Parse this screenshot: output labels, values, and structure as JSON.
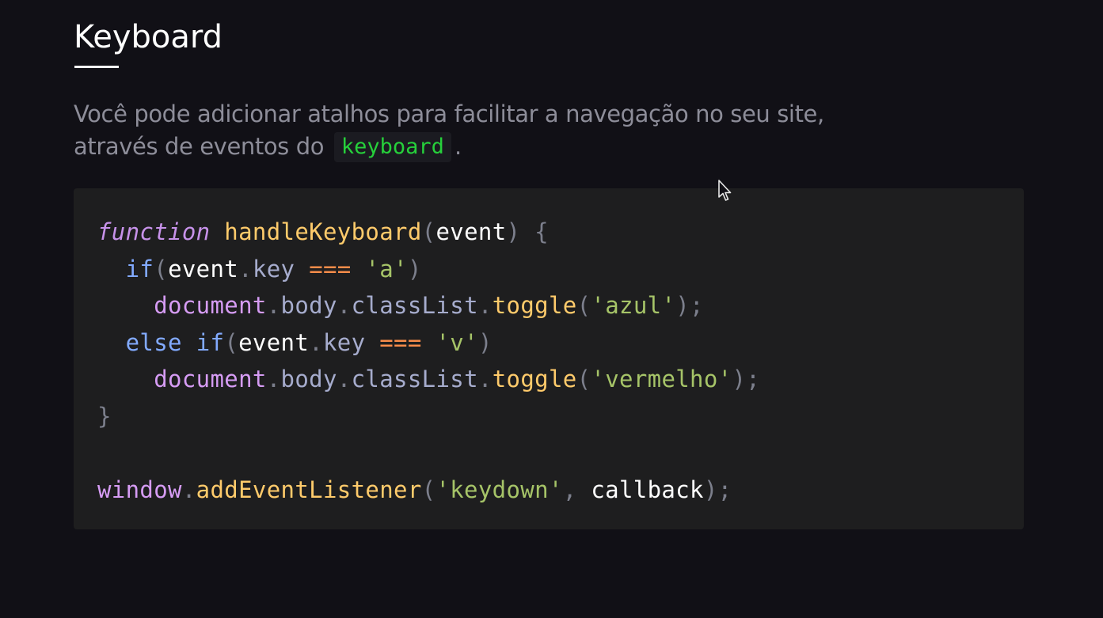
{
  "heading": {
    "title": "Keyboard"
  },
  "intro": {
    "line1": "Você pode adicionar atalhos para facilitar a navegação no seu site,",
    "line2_before": "através de eventos do",
    "inline_code": "keyboard",
    "line2_after": "."
  },
  "code": {
    "l1": {
      "keyword": "function",
      "name": "handleKeyboard",
      "open": "(",
      "param": "event",
      "close": ")",
      "brace": "{"
    },
    "l2": {
      "keyword": "if",
      "open": "(",
      "obj": "event",
      "dot": ".",
      "prop": "key",
      "op": "===",
      "str": "'a'",
      "close": ")"
    },
    "l3": {
      "obj": "document",
      "dot1": ".",
      "prop1": "body",
      "dot2": ".",
      "prop2": "classList",
      "dot3": ".",
      "method": "toggle",
      "open": "(",
      "str": "'azul'",
      "close": ");"
    },
    "l4": {
      "keyword1": "else",
      "keyword2": "if",
      "open": "(",
      "obj": "event",
      "dot": ".",
      "prop": "key",
      "op": "===",
      "str": "'v'",
      "close": ")"
    },
    "l5": {
      "obj": "document",
      "dot1": ".",
      "prop1": "body",
      "dot2": ".",
      "prop2": "classList",
      "dot3": ".",
      "method": "toggle",
      "open": "(",
      "str": "'vermelho'",
      "close": ");"
    },
    "l6": {
      "brace": "}"
    },
    "l8": {
      "obj": "window",
      "dot": ".",
      "method": "addEventListener",
      "open": "(",
      "str": "'keydown'",
      "comma": ",",
      "arg": "callback",
      "close": ");"
    }
  },
  "colors": {
    "background": "#111016",
    "code_background": "#1e1e1f",
    "inline_code_color": "#26d03b",
    "muted_text": "#8d8d99"
  },
  "cursor": {
    "icon": "mouse-pointer-icon"
  }
}
